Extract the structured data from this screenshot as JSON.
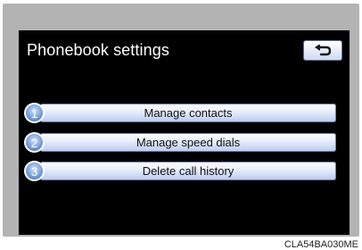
{
  "header": {
    "title": "Phonebook settings",
    "back_icon": "back-arrow-icon"
  },
  "menu": {
    "items": [
      {
        "number": "1",
        "label": "Manage contacts"
      },
      {
        "number": "2",
        "label": "Manage speed dials"
      },
      {
        "number": "3",
        "label": "Delete call history"
      }
    ]
  },
  "figure_code": "CLA54BA030ME",
  "colors": {
    "screen_bg": "#000000",
    "bezel": "#b3b3b3",
    "button_gradient_top": "#ffffff",
    "button_gradient_bottom": "#b9c8ec",
    "badge": "#5d86c8"
  }
}
